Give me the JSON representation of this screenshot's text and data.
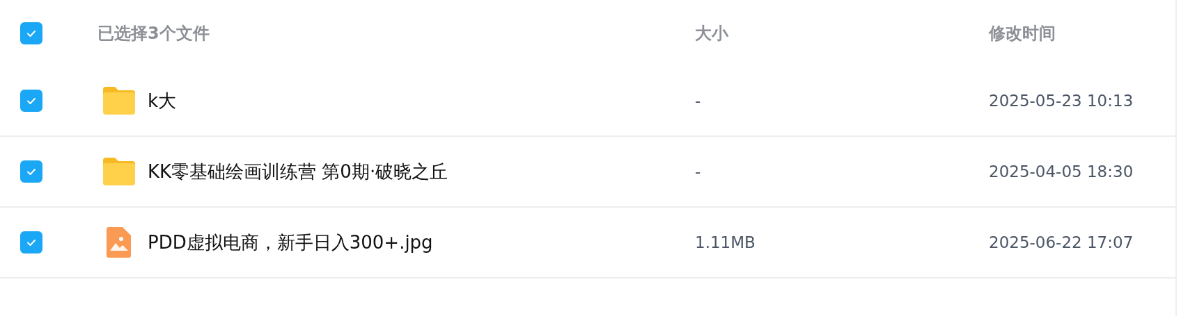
{
  "header": {
    "checked": true,
    "selection_label": "已选择3个文件",
    "columns": [
      "大小",
      "修改时间"
    ]
  },
  "rows": [
    {
      "kind": "folder",
      "name": "k大",
      "size": "-",
      "modified": "2025-05-23 10:13",
      "checked": true
    },
    {
      "kind": "folder",
      "name": "KK零基础绘画训练营 第0期·破晓之丘",
      "size": "-",
      "modified": "2025-04-05 18:30",
      "checked": true
    },
    {
      "kind": "image",
      "name": "PDD虚拟电商，新手日入300+.jpg",
      "size": "1.11MB",
      "modified": "2025-06-22 17:07",
      "checked": true
    }
  ]
}
